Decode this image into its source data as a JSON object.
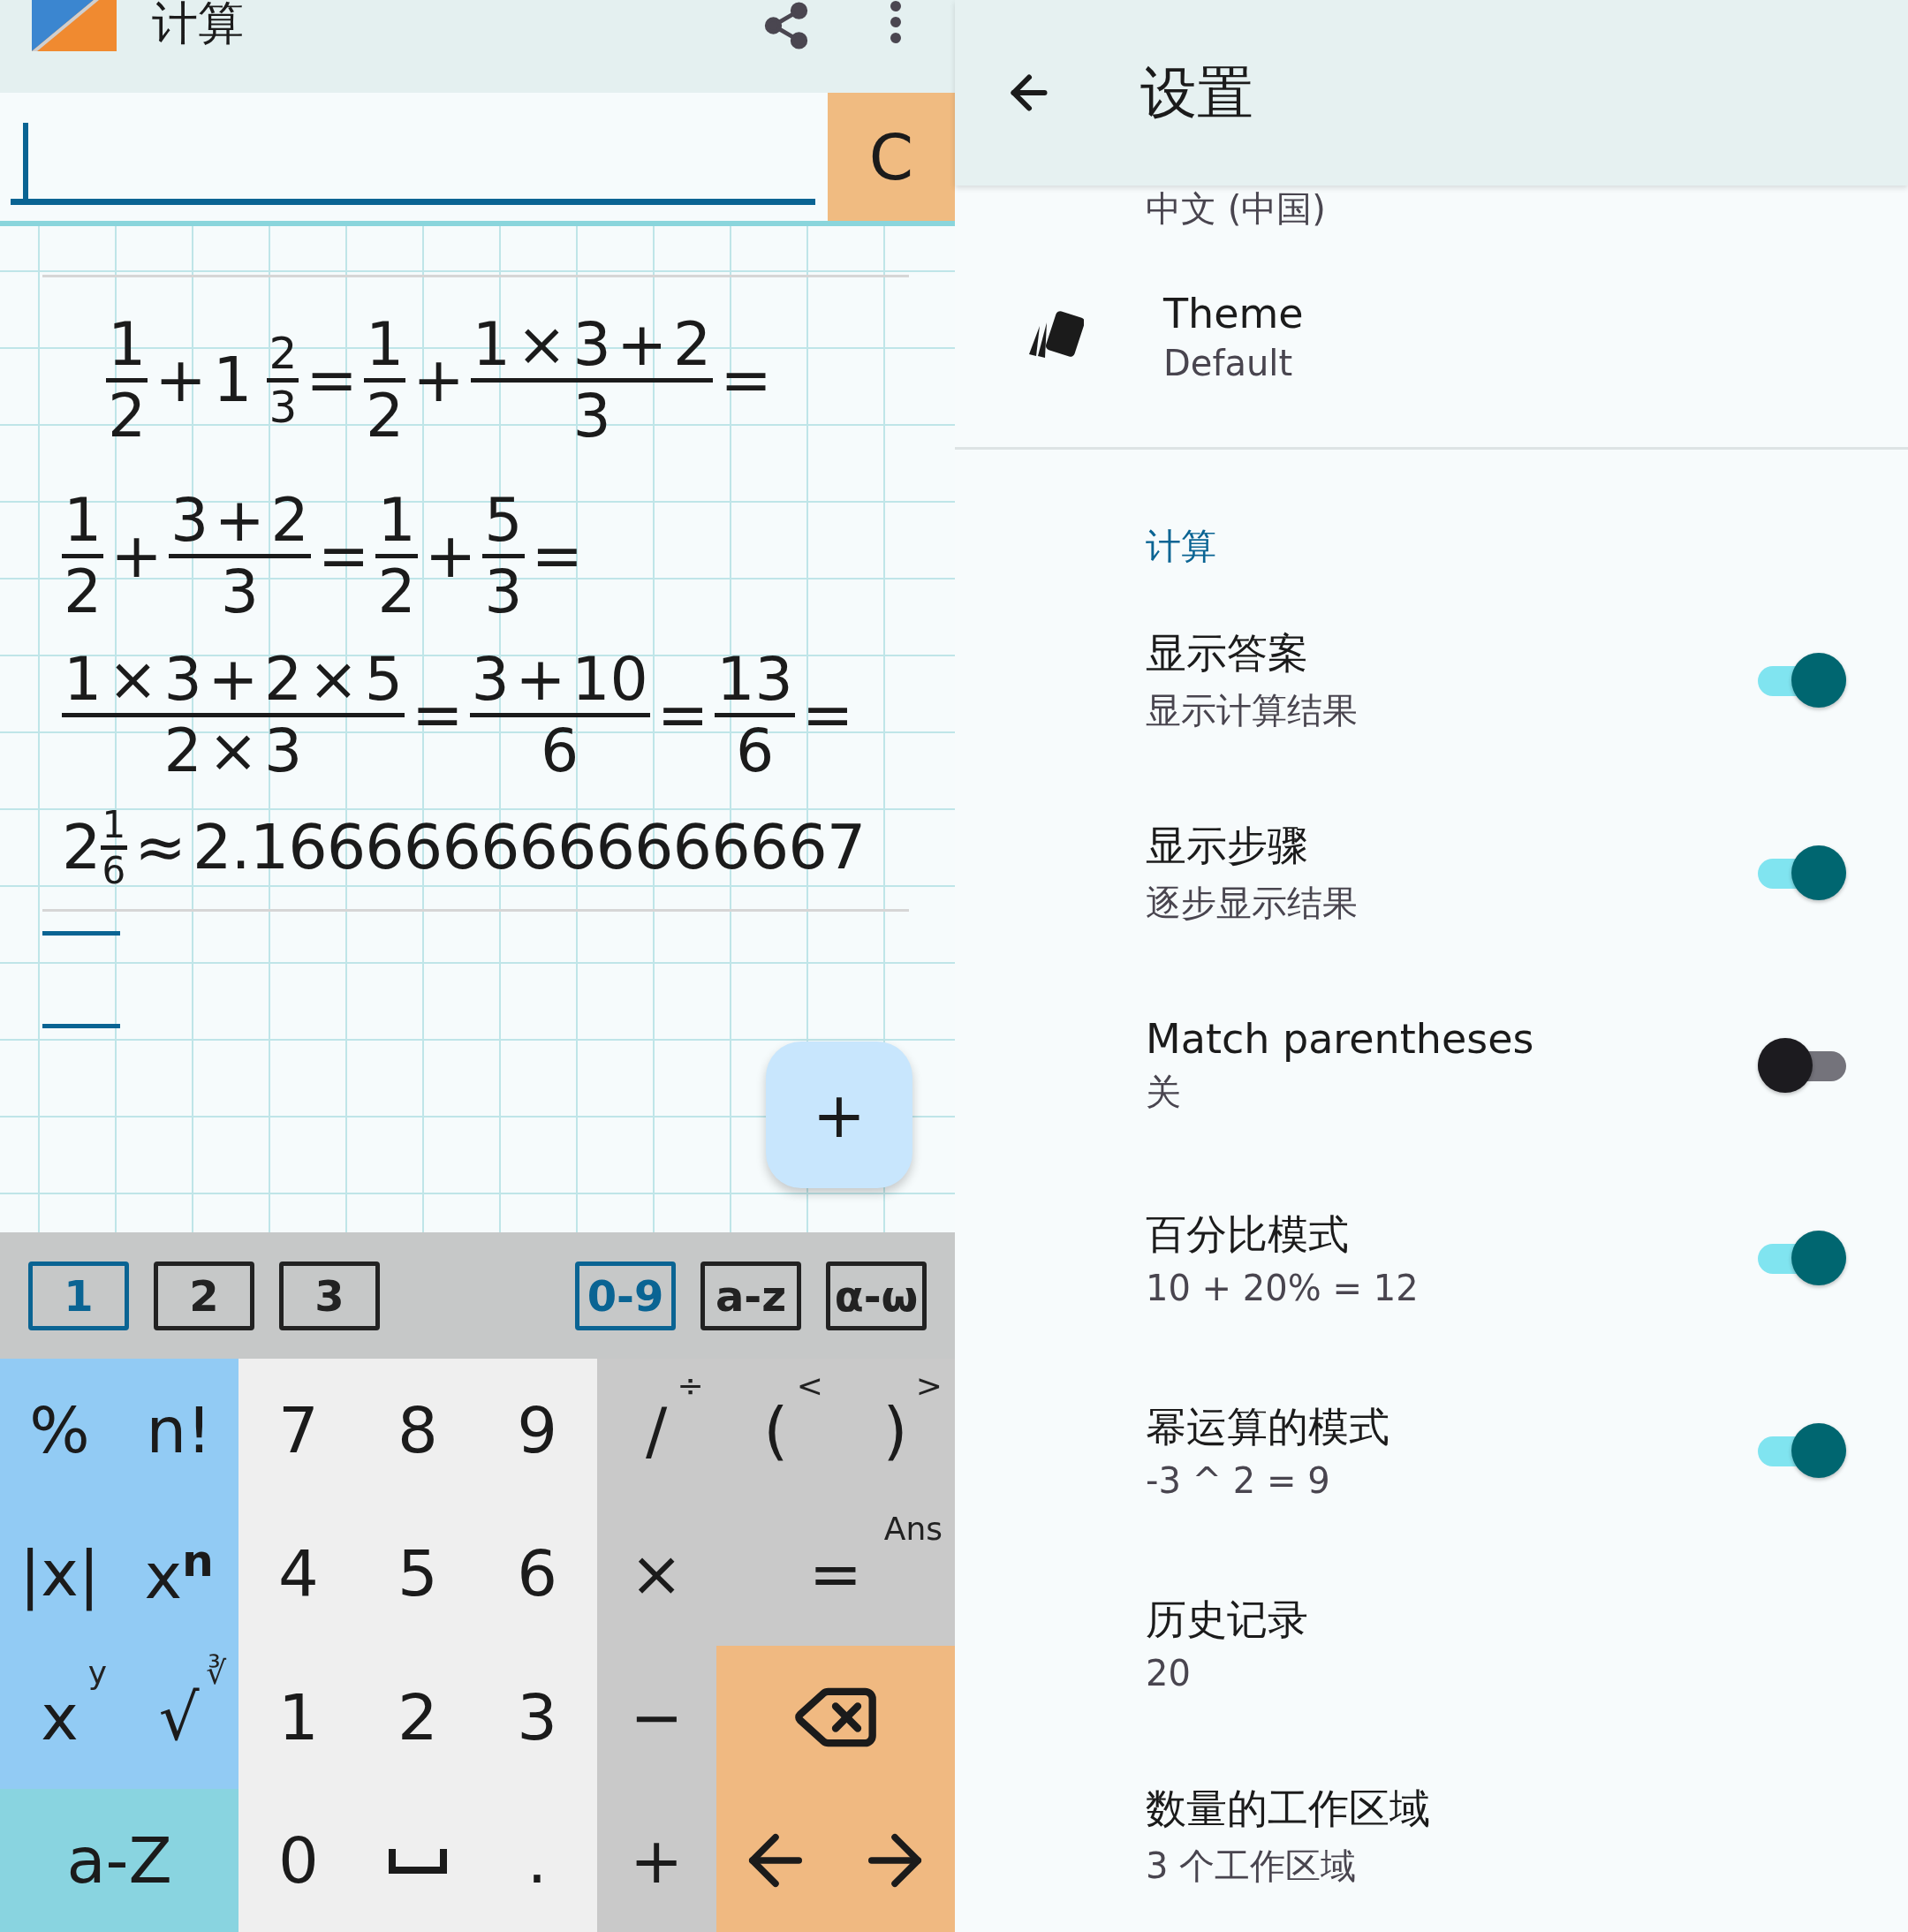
{
  "calculator": {
    "app_bar": {
      "title": "计算"
    },
    "input": {
      "clear_label": "C"
    },
    "math": {
      "lines": [
        [
          {
            "kind": "frac",
            "num": "1",
            "den": "2"
          },
          {
            "kind": "op",
            "text": "+"
          },
          {
            "kind": "mixed",
            "whole": "1",
            "num": "2",
            "den": "3"
          },
          {
            "kind": "op",
            "text": "="
          },
          {
            "kind": "frac",
            "num": "1",
            "den": "2"
          },
          {
            "kind": "op",
            "text": "+"
          },
          {
            "kind": "frac",
            "num": "1 × 3 + 2",
            "den": "3"
          },
          {
            "kind": "op",
            "text": "="
          }
        ],
        [
          {
            "kind": "frac",
            "num": "1",
            "den": "2"
          },
          {
            "kind": "op",
            "text": "+"
          },
          {
            "kind": "frac",
            "num": "3 + 2",
            "den": "3"
          },
          {
            "kind": "op",
            "text": "="
          },
          {
            "kind": "frac",
            "num": "1",
            "den": "2"
          },
          {
            "kind": "op",
            "text": "+"
          },
          {
            "kind": "frac",
            "num": "5",
            "den": "3"
          },
          {
            "kind": "op",
            "text": "="
          }
        ],
        [
          {
            "kind": "frac",
            "num": "1 × 3 + 2 × 5",
            "den": "2 × 3"
          },
          {
            "kind": "op",
            "text": "="
          },
          {
            "kind": "frac",
            "num": "3 + 10",
            "den": "6"
          },
          {
            "kind": "op",
            "text": "="
          },
          {
            "kind": "frac",
            "num": "13",
            "den": "6"
          },
          {
            "kind": "op",
            "text": "="
          }
        ],
        [
          {
            "kind": "result",
            "whole": "2",
            "num": "1",
            "den": "6"
          },
          {
            "kind": "op",
            "text": "≈"
          },
          {
            "kind": "text",
            "text": "2.1666666666666667"
          }
        ]
      ]
    },
    "fab": {
      "label": "+"
    },
    "workspace_tabs": [
      {
        "label": "1",
        "selected": true
      },
      {
        "label": "2",
        "selected": false
      },
      {
        "label": "3",
        "selected": false
      }
    ],
    "keyboard_tabs": [
      {
        "label": "0-9",
        "selected": true
      },
      {
        "label": "a-z",
        "selected": false
      },
      {
        "label": "α-ω",
        "selected": false
      }
    ],
    "keys": [
      {
        "kind": "fn",
        "label": "%"
      },
      {
        "kind": "fn",
        "label": "n!"
      },
      {
        "kind": "digit",
        "label": "7"
      },
      {
        "kind": "digit",
        "label": "8"
      },
      {
        "kind": "digit",
        "label": "9"
      },
      {
        "kind": "op",
        "label": "/",
        "hint": "÷"
      },
      {
        "kind": "op",
        "label": "(",
        "hint": "<"
      },
      {
        "kind": "op",
        "label": ")",
        "hint": ">"
      },
      {
        "kind": "fn",
        "label": "|x|"
      },
      {
        "kind": "fn",
        "label": "x$^{n}$"
      },
      {
        "kind": "digit",
        "label": "4"
      },
      {
        "kind": "digit",
        "label": "5"
      },
      {
        "kind": "digit",
        "label": "6"
      },
      {
        "kind": "op",
        "label": "×"
      },
      {
        "kind": "equals",
        "label": "=",
        "hint": "Ans"
      },
      {
        "kind": "fn",
        "label": "x",
        "hint": "y"
      },
      {
        "kind": "fn",
        "label": "√",
        "hint": "∛"
      },
      {
        "kind": "digit",
        "label": "1"
      },
      {
        "kind": "digit",
        "label": "2"
      },
      {
        "kind": "digit",
        "label": "3"
      },
      {
        "kind": "op",
        "label": "−"
      },
      {
        "kind": "backspace"
      },
      {
        "kind": "letters",
        "label": "a-Z"
      },
      {
        "kind": "digit",
        "label": "0"
      },
      {
        "kind": "space"
      },
      {
        "kind": "digit",
        "label": "."
      },
      {
        "kind": "op",
        "label": "+"
      },
      {
        "kind": "left"
      },
      {
        "kind": "right"
      }
    ]
  },
  "settings": {
    "title": "设置",
    "language": "中文 (中国)",
    "theme": {
      "title": "Theme",
      "value": "Default"
    },
    "section": "计算",
    "items": [
      {
        "kind": "switch",
        "title": "显示答案",
        "subtitle": "显示计算结果",
        "on": true
      },
      {
        "kind": "switch",
        "title": "显示步骤",
        "subtitle": "逐步显示结果",
        "on": true
      },
      {
        "kind": "switch",
        "title": "Match parentheses",
        "subtitle": "关",
        "on": false
      },
      {
        "kind": "switch",
        "title": "百分比模式",
        "subtitle": "10 + 20% = 12",
        "on": true
      },
      {
        "kind": "switch",
        "title": "幂运算的模式",
        "subtitle": "-3 ^ 2 = 9",
        "on": true
      },
      {
        "kind": "plain",
        "title": "历史记录",
        "subtitle": "20"
      },
      {
        "kind": "plain",
        "title": "数量的工作区域",
        "subtitle": "3 个工作区域"
      }
    ]
  }
}
